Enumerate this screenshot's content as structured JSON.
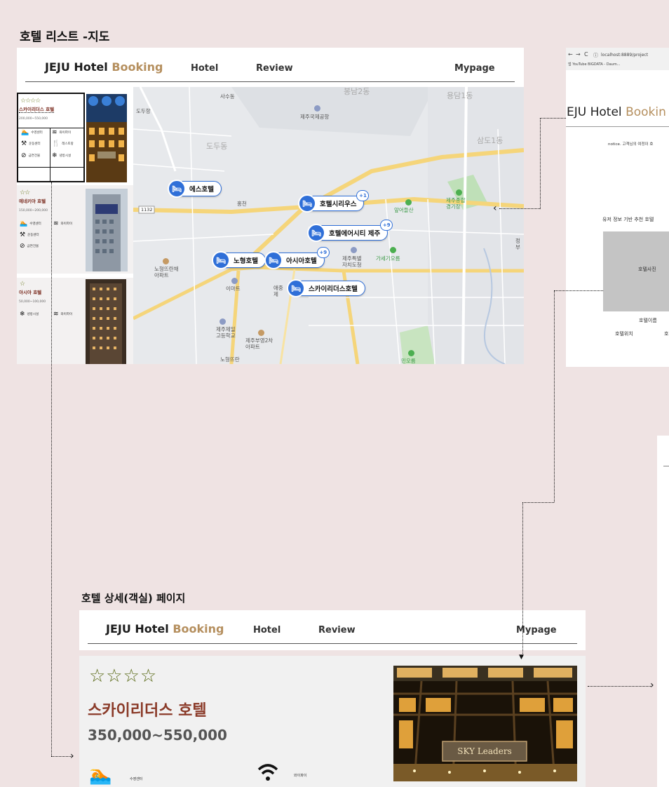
{
  "titles": {
    "list_map": "호텔 리스트 -지도",
    "detail": "호텔 상세(객실) 페이지"
  },
  "nav": {
    "logo_main": "JEJU Hotel ",
    "logo_accent": "Booking",
    "hotel": "Hotel",
    "review": "Review",
    "mypage": "Mypage"
  },
  "hotels": [
    {
      "stars": "☆☆☆☆",
      "name": "스카이리더스 호텔",
      "price": "200,000~550,000",
      "amenities": [
        "수영센터",
        "와이파이",
        "운동센터",
        "레스토랑",
        "금연건물",
        "냉방시설"
      ]
    },
    {
      "stars": "☆☆",
      "name": "에네키아 호텔",
      "price": "150,000~200,000",
      "amenities": [
        "수영센터",
        "와이파이",
        "운동센터",
        "금연건물"
      ]
    },
    {
      "stars": "☆",
      "name": "아시아 호텔",
      "price": "50,000~100,000",
      "amenities": [
        "냉방시설",
        "와이파이"
      ]
    }
  ],
  "map": {
    "markers": [
      {
        "label": "에스호텔",
        "badge": ""
      },
      {
        "label": "호텔시리우스",
        "badge": "+1"
      },
      {
        "label": "호텔에어시티 제주",
        "badge": "+9"
      },
      {
        "label": "노형호텔",
        "badge": ""
      },
      {
        "label": "아시아호텔",
        "badge": "+9"
      },
      {
        "label": "스카이리더스호텔",
        "badge": ""
      }
    ],
    "labels": {
      "sasu": "사수동",
      "bongnam": "봉남2동",
      "yongdam": "용담1동",
      "dodu": "도두동",
      "dodu2": "도두항",
      "airport": "제주국제공항",
      "samdo": "삼도1동",
      "road": "1132",
      "hongcheon": "홍천",
      "saeoreum": "앞어들산",
      "stadium": "제주종합\n경기장",
      "jeju_city": "제주특별\n자치도청",
      "gasemi": "가세기오름",
      "noheong_apt": "노형뜨란채\n아파트",
      "emart": "이마트",
      "jejucheil": "제주제일\n고등학교",
      "busan": "제주부영2차\n아파트",
      "jeong": "정\n부",
      "noheong": "노형뜨란",
      "bottom_right": "민오름",
      "mid_apt": "애중\n제"
    }
  },
  "browser": {
    "url": "localhost:8889/project",
    "bookmarks": "앱   YouTube   BIGDATA - Daum...",
    "logo_main": "JEJU Hotel ",
    "logo_accent": "Bookin",
    "notice": "notice. 고객님의 여정이 호",
    "recommend": "유저 정보 기반 추천 호텔",
    "photo": "호텔사진",
    "name": "호텔이름",
    "location": "호텔위치",
    "extra": "호"
  },
  "detail": {
    "stars": "☆☆☆☆",
    "name": "스카이리더스 호텔",
    "price": "350,000~550,000",
    "amen1": "수영센터",
    "amen2": "와이파이",
    "sign": "SKY Leaders"
  },
  "colors": {
    "background": "#efe3e3",
    "accent": "#b58f5e",
    "marker": "#2f6fd8",
    "hotel_name": "#8a3a28",
    "stars": "#5a6a17"
  }
}
